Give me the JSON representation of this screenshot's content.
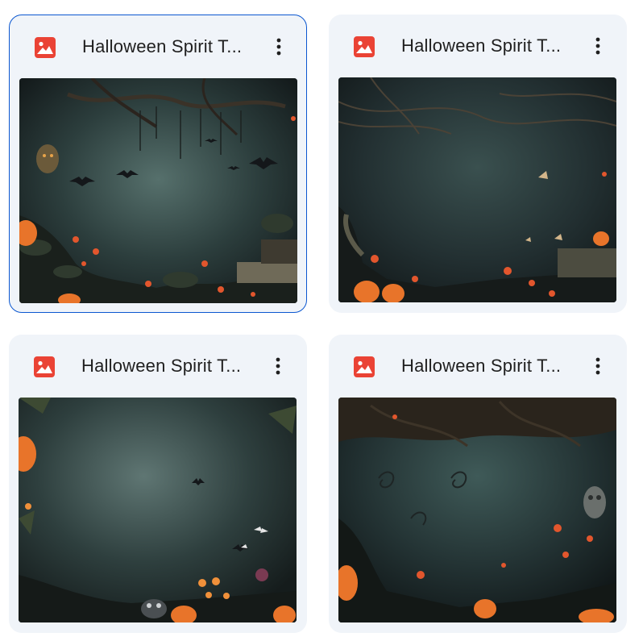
{
  "files": [
    {
      "title": "Halloween Spirit T...",
      "icon": "image-file-icon",
      "selected": true
    },
    {
      "title": "Halloween Spirit T...",
      "icon": "image-file-icon",
      "selected": false
    },
    {
      "title": "Halloween Spirit T...",
      "icon": "image-file-icon",
      "selected": false
    },
    {
      "title": "Halloween Spirit T...",
      "icon": "image-file-icon",
      "selected": false
    }
  ],
  "colors": {
    "card_bg": "#f0f4f9",
    "selected_border": "#0b57d0",
    "image_icon_red": "#ea4335",
    "title_text": "#1f1f1f"
  }
}
